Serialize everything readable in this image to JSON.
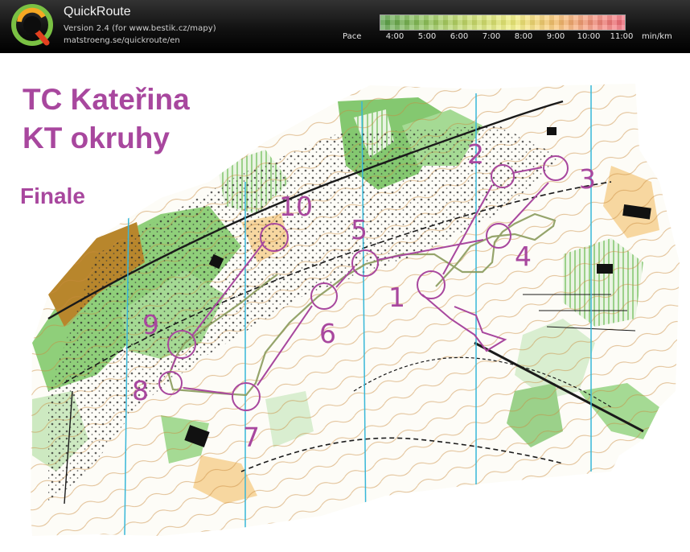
{
  "app": {
    "name": "QuickRoute",
    "version": "Version 2.4  (for www.bestik.cz/mapy)",
    "website": "matstroeng.se/quickroute/en"
  },
  "pace_scale": {
    "label": "Pace",
    "unit": "min/km",
    "ticks": [
      "4:00",
      "5:00",
      "6:00",
      "7:00",
      "8:00",
      "9:00",
      "10:00",
      "11:00"
    ]
  },
  "map": {
    "title_line1": "TC Kateřina",
    "title_line2": "KT okruhy",
    "title_line3": "Finale",
    "course_color": "#a8479e",
    "controls": [
      {
        "label": "1"
      },
      {
        "label": "2"
      },
      {
        "label": "3"
      },
      {
        "label": "4"
      },
      {
        "label": "5"
      },
      {
        "label": "6"
      },
      {
        "label": "7"
      },
      {
        "label": "8"
      },
      {
        "label": "9"
      },
      {
        "label": "10"
      }
    ]
  }
}
